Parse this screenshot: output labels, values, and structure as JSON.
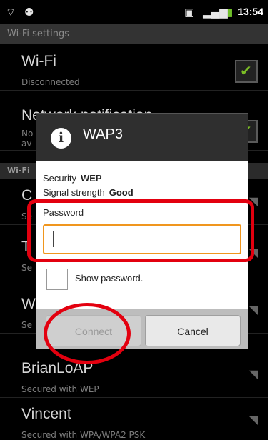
{
  "status_bar": {
    "wifi_icon": "wifi-signal-icon",
    "usb_icon": "usb-debug-icon",
    "sim_icon": "sim-icon",
    "signal_icon": "cell-signal-icon",
    "battery_icon": "battery-icon",
    "time": "13:54"
  },
  "header": {
    "title": "Wi-Fi settings"
  },
  "list": {
    "wifi": {
      "title": "Wi-Fi",
      "subtitle": "Disconnected",
      "checked": true
    },
    "network_notification": {
      "title": "Network notification",
      "subtitle_1": "No",
      "subtitle_2": "av"
    },
    "section_label": "Wi-Fi",
    "networks": [
      {
        "title": "C",
        "subtitle": "Se"
      },
      {
        "title": "T",
        "subtitle": "Se"
      },
      {
        "title": "W",
        "subtitle": "Se"
      },
      {
        "title": "BrianLoAP",
        "subtitle": "Secured with WEP"
      },
      {
        "title": "Vincent",
        "subtitle": "Secured with WPA/WPA2 PSK"
      }
    ]
  },
  "dialog": {
    "title": "WAP3",
    "security_label": "Security",
    "security_value": "WEP",
    "signal_label": "Signal strength",
    "signal_value": "Good",
    "password_label": "Password",
    "password_value": "",
    "show_password_label": "Show password.",
    "show_password_checked": false,
    "connect_label": "Connect",
    "cancel_label": "Cancel"
  },
  "colors": {
    "annotation": "#e3000f",
    "input_focus": "#f0961e",
    "check_green": "#7bbd25"
  }
}
